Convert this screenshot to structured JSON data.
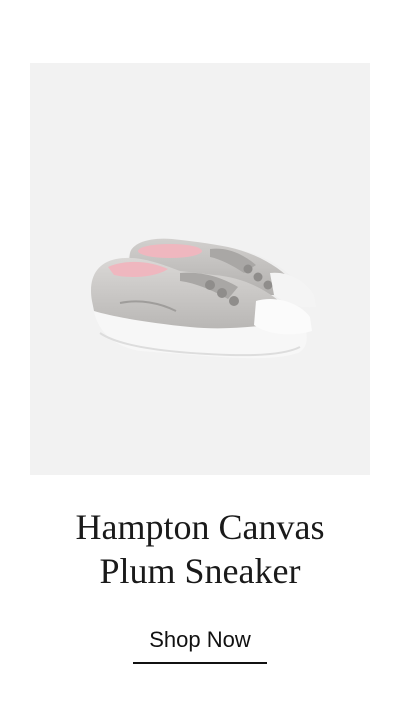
{
  "product": {
    "image_alt": "Silver glitter canvas slip-on sneakers with white rubber soles",
    "title_line1": "Hampton Canvas",
    "title_line2": "Plum Sneaker",
    "cta_label": "Shop Now"
  },
  "colors": {
    "image_background": "#f2f2f2",
    "shoe_upper": "#c9c7c5",
    "sole": "#f7f7f7",
    "lining": "#efb7bf",
    "text": "#1a1a1a"
  }
}
